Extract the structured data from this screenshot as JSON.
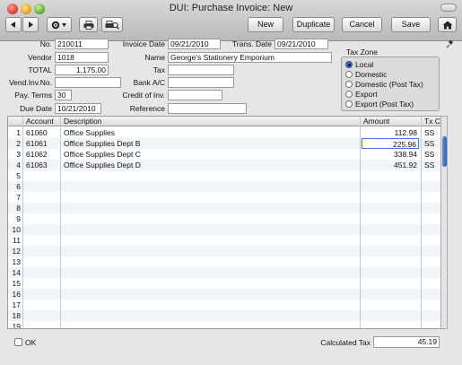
{
  "window": {
    "title": "DUI: Purchase Invoice: New"
  },
  "toolbar": {
    "new_label": "New",
    "duplicate_label": "Duplicate",
    "cancel_label": "Cancel",
    "save_label": "Save"
  },
  "form": {
    "no": {
      "label": "No.",
      "value": "210011"
    },
    "vendor": {
      "label": "Vendor",
      "value": "1018"
    },
    "total": {
      "label": "TOTAL",
      "value": "1,175.00"
    },
    "vend_inv_no": {
      "label": "Vend.Inv.No.",
      "value": ""
    },
    "pay_terms": {
      "label": "Pay. Terms",
      "value": "30"
    },
    "due_date": {
      "label": "Due Date",
      "value": "10/21/2010"
    },
    "invoice_date": {
      "label": "Invoice Date",
      "value": "09/21/2010"
    },
    "name": {
      "label": "Name",
      "value": "George's Stationery Emporium"
    },
    "tax": {
      "label": "Tax",
      "value": ""
    },
    "bank_ac": {
      "label": "Bank A/C",
      "value": ""
    },
    "credit_of_inv": {
      "label": "Credit of Inv.",
      "value": ""
    },
    "reference": {
      "label": "Reference",
      "value": ""
    },
    "trans_date": {
      "label": "Trans. Date",
      "value": "09/21/2010"
    }
  },
  "tax_zone": {
    "label": "Tax Zone",
    "options": [
      "Local",
      "Domestic",
      "Domestic (Post Tax)",
      "Export",
      "Export (Post Tax)"
    ],
    "selected": "Local"
  },
  "grid": {
    "headers": {
      "account": "Account",
      "description": "Description",
      "amount": "Amount",
      "tax_code": "Tx Cd"
    },
    "row_numbers": [
      "1",
      "2",
      "3",
      "4",
      "5",
      "6",
      "7",
      "8",
      "9",
      "10",
      "11",
      "12",
      "13",
      "14",
      "15",
      "16",
      "17",
      "18",
      "19"
    ],
    "rows": [
      {
        "account": "61060",
        "description": "Office Supplies",
        "amount": "112.98",
        "tax_code": "SS"
      },
      {
        "account": "61061",
        "description": "Office Supplies Dept B",
        "amount": "225.96",
        "tax_code": "SS"
      },
      {
        "account": "61062",
        "description": "Office Supplies Dept C",
        "amount": "338.94",
        "tax_code": "SS"
      },
      {
        "account": "61063",
        "description": "Office Supplies Dept D",
        "amount": "451.92",
        "tax_code": "SS"
      }
    ]
  },
  "footer": {
    "ok_label": "OK",
    "calculated_tax_label": "Calculated Tax",
    "calculated_tax_value": "45.19"
  }
}
